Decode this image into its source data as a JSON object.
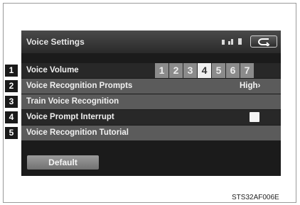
{
  "screen": {
    "title": "Voice Settings",
    "status_icons": [
      "battery-icon",
      "signal-icon",
      "cellular-icon"
    ],
    "back_icon": "back-arrow-icon",
    "rows": [
      {
        "number": "1",
        "label": "Voice Volume",
        "volume_options": [
          "1",
          "2",
          "3",
          "4",
          "5",
          "6",
          "7"
        ],
        "selected_volume": "4"
      },
      {
        "number": "2",
        "label": "Voice Recognition Prompts",
        "value": "High›"
      },
      {
        "number": "3",
        "label": "Train Voice Recognition"
      },
      {
        "number": "4",
        "label": "Voice Prompt Interrupt",
        "checked": false
      },
      {
        "number": "5",
        "label": "Voice Recognition Tutorial"
      }
    ],
    "default_label": "Default"
  },
  "caption": "STS32AF006E",
  "colors": {
    "screen_bg": "#1b1b1b",
    "row_dark": "#282828",
    "row_light": "#5b5b5b",
    "selected_volume": "#efefef",
    "volume_button": "#8b8b8b"
  }
}
